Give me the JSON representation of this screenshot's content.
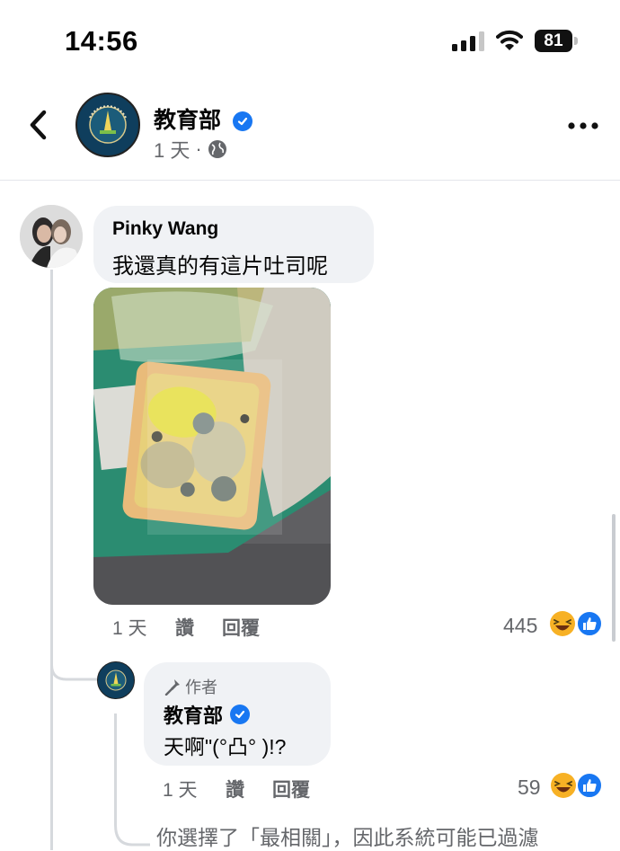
{
  "status_bar": {
    "time": "14:56",
    "battery": "81"
  },
  "header": {
    "page_name": "教育部",
    "post_time": "1 天",
    "separator": "·"
  },
  "comment": {
    "author": "Pinky Wang",
    "text": "我還真的有這片吐司呢",
    "time": "1 天",
    "like_label": "讚",
    "reply_label": "回覆",
    "reaction_count": "445"
  },
  "reply": {
    "badge": "作者",
    "author": "教育部",
    "text": "天啊\"(°凸° )!?",
    "time": "1 天",
    "like_label": "讚",
    "reply_label": "回覆",
    "reaction_count": "59"
  },
  "notice": {
    "text": "你選擇了「最相關」，因此系統可能已過濾"
  },
  "colors": {
    "verified": "#1877f2",
    "haha": "#f7b125",
    "like": "#1877f2",
    "secondary_text": "#65676b",
    "bubble": "#f0f2f5"
  }
}
